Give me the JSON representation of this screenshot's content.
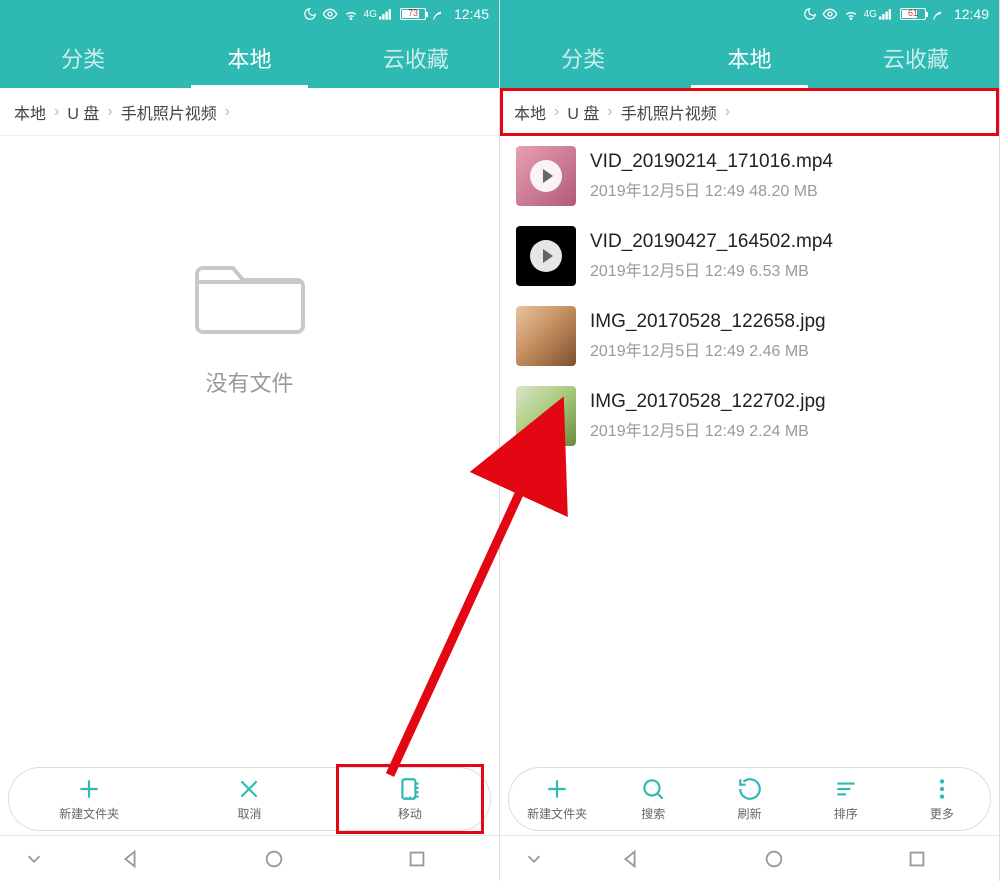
{
  "colors": {
    "accent": "#2fb9b3",
    "annotation": "#e30613"
  },
  "left": {
    "status": {
      "battery_text": "73",
      "battery_pct": 73,
      "time": "12:45",
      "net_label": "4G"
    },
    "tabs": [
      {
        "label": "分类",
        "active": false
      },
      {
        "label": "本地",
        "active": true
      },
      {
        "label": "云收藏",
        "active": false
      }
    ],
    "breadcrumb": [
      "本地",
      "U 盘",
      "手机照片视频"
    ],
    "empty_text": "没有文件",
    "toolbar": [
      {
        "id": "new-folder",
        "label": "新建文件夹",
        "icon": "plus"
      },
      {
        "id": "cancel",
        "label": "取消",
        "icon": "close"
      },
      {
        "id": "move",
        "label": "移动",
        "icon": "move",
        "highlight": true
      }
    ]
  },
  "right": {
    "status": {
      "battery_text": "61",
      "battery_pct": 61,
      "time": "12:49",
      "net_label": "4G"
    },
    "tabs": [
      {
        "label": "分类",
        "active": false
      },
      {
        "label": "本地",
        "active": true
      },
      {
        "label": "云收藏",
        "active": false
      }
    ],
    "breadcrumb": [
      "本地",
      "U 盘",
      "手机照片视频"
    ],
    "breadcrumb_highlight": true,
    "files": [
      {
        "name": "VID_20190214_171016.mp4",
        "date": "2019年12月5日 12:49",
        "size": "48.20 MB",
        "thumb": "video1"
      },
      {
        "name": "VID_20190427_164502.mp4",
        "date": "2019年12月5日 12:49",
        "size": "6.53 MB",
        "thumb": "video-dark"
      },
      {
        "name": "IMG_20170528_122658.jpg",
        "date": "2019年12月5日 12:49",
        "size": "2.46 MB",
        "thumb": "photo1"
      },
      {
        "name": "IMG_20170528_122702.jpg",
        "date": "2019年12月5日 12:49",
        "size": "2.24 MB",
        "thumb": "photo2"
      }
    ],
    "toolbar": [
      {
        "id": "new-folder",
        "label": "新建文件夹",
        "icon": "plus"
      },
      {
        "id": "search",
        "label": "搜索",
        "icon": "search"
      },
      {
        "id": "refresh",
        "label": "刷新",
        "icon": "refresh"
      },
      {
        "id": "sort",
        "label": "排序",
        "icon": "sort"
      },
      {
        "id": "more",
        "label": "更多",
        "icon": "more"
      }
    ]
  }
}
